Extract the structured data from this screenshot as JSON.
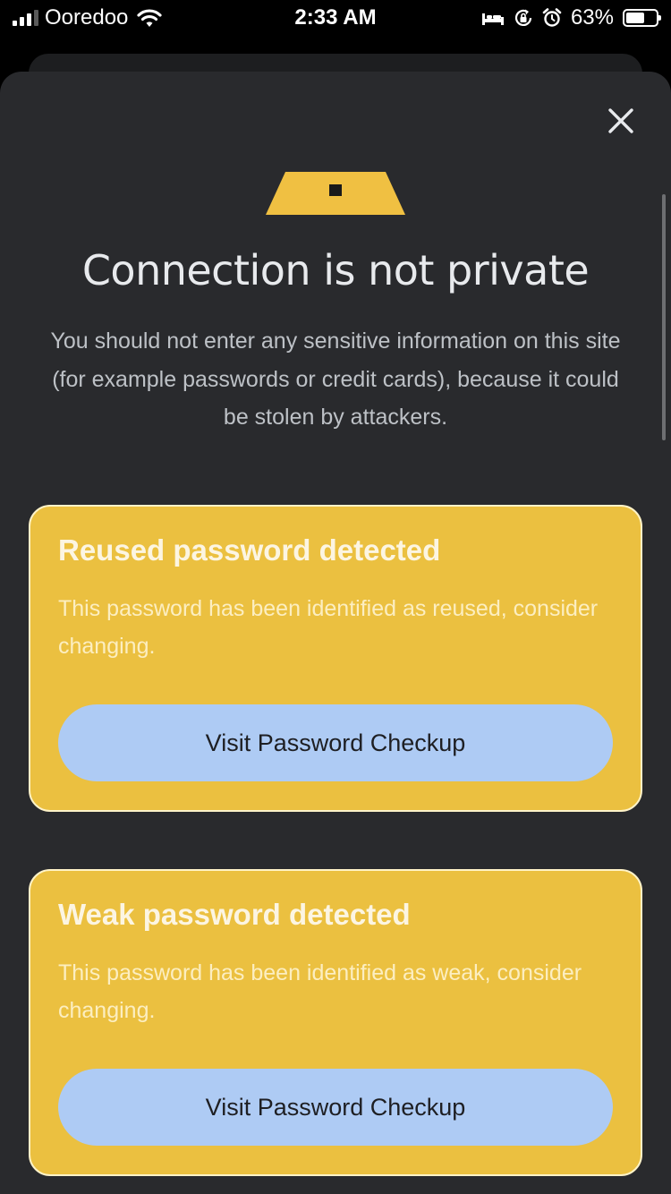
{
  "status_bar": {
    "carrier": "Ooredoo",
    "time": "2:33 AM",
    "battery_percent": "63%",
    "battery_level": 0.63,
    "icons": [
      "signal-icon",
      "wifi-icon",
      "bed-icon",
      "orientation-lock-icon",
      "alarm-icon",
      "battery-icon"
    ]
  },
  "dialog": {
    "close_icon": "close-icon",
    "warning_icon": "warning-triangle-icon",
    "title": "Connection is not private",
    "description": "You should not enter any sensitive information on this site (for example passwords or credit cards), because it could be stolen by attackers."
  },
  "cards": [
    {
      "title": "Reused password detected",
      "body": "This password has been identified as reused, consider changing.",
      "button_label": "Visit Password Checkup"
    },
    {
      "title": "Weak password detected",
      "body": "This password has been identified as weak, consider changing.",
      "button_label": "Visit Password Checkup"
    }
  ],
  "colors": {
    "sheet_background": "#292a2d",
    "card_background": "#ebc040",
    "card_border": "#fff3c8",
    "button_background": "#aecbf4",
    "warning_accent": "#f0c042"
  }
}
